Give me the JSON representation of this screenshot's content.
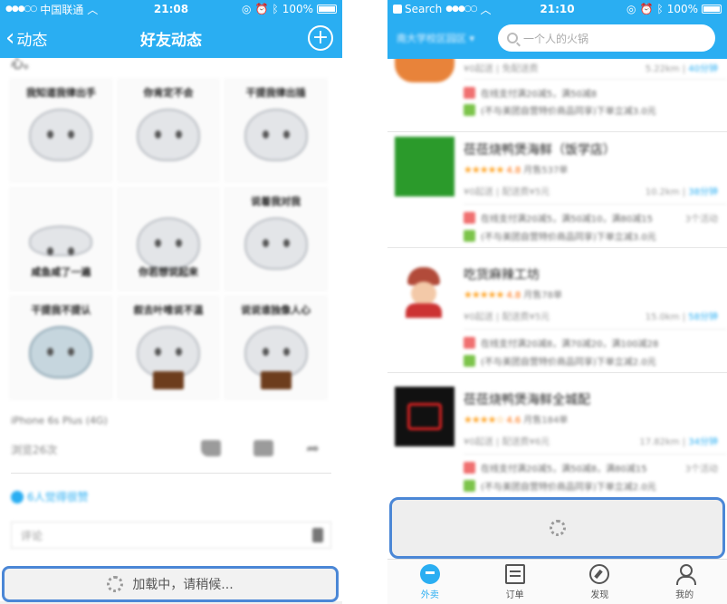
{
  "left_phone": {
    "status_bar": {
      "carrier": "中国联通",
      "time": "21:08",
      "battery": "100%"
    },
    "nav": {
      "back_label": "动态",
      "title": "好友动态",
      "add_icon": "plus-circle-icon"
    },
    "post": {
      "tail_text": "心。",
      "stickers": [
        {
          "caption": "我知道我律出手",
          "variant": "normal",
          "cap_pos": "top"
        },
        {
          "caption": "你肯定不会",
          "variant": "normal",
          "cap_pos": "top"
        },
        {
          "caption": "干提我律出插",
          "variant": "normal",
          "cap_pos": "top"
        },
        {
          "caption": "咸鱼咸了一遍",
          "variant": "flat",
          "cap_pos": "bottom"
        },
        {
          "caption": "你若想说起来",
          "variant": "normal",
          "cap_pos": "bottom"
        },
        {
          "caption": "说着我对我",
          "variant": "normal",
          "cap_pos": "top"
        },
        {
          "caption": "干提我不提认",
          "variant": "blue",
          "cap_pos": "top"
        },
        {
          "caption": "叙去叶唯说不温",
          "variant": "book",
          "cap_pos": "top"
        },
        {
          "caption": "说说谁独像人心",
          "variant": "book",
          "cap_pos": "top"
        }
      ],
      "device": "iPhone 6s Plus (4G)",
      "views": "浏览26次",
      "liked": "6人觉得很赞",
      "comment_placeholder": "评论"
    },
    "loading_text": "加载中，请稍候..."
  },
  "right_phone": {
    "status_bar": {
      "back_app": "Search",
      "time": "21:10",
      "battery": "100%"
    },
    "header": {
      "address": "南大学校区园区",
      "search_placeholder": "一个人的火锅"
    },
    "shops": [
      {
        "name": "",
        "logo_color": "#e8833a",
        "stars": "",
        "score": "",
        "sales": "",
        "fee": "¥0起送 | 免配送费",
        "distance": "5.22km",
        "time": "40分钟",
        "promos": [
          "在线支付满20减5，满50减8",
          "(不与美团自营特价商品同享)下单立减3.0元"
        ],
        "promo_count": ""
      },
      {
        "name": "莅莅烧鸭煲海鲜（饭学店）",
        "logo_color": "#2b9a2b",
        "stars": "★★★★★",
        "score": "4.8",
        "sales": "月售537单",
        "fee": "¥0起送 | 配送费¥5元",
        "distance": "10.2km",
        "time": "38分钟",
        "promos": [
          "在线支付满20减5，满50减10，满80减15",
          "(不与美团自营特价商品同享)下单立减3.0元"
        ],
        "promo_count": "3个活动"
      },
      {
        "name": "吃货麻辣工坊",
        "logo_color": "#b24b3a",
        "stars": "★★★★★",
        "score": "4.8",
        "sales": "月售78单",
        "fee": "¥0起送 | 配送费¥5元",
        "distance": "15.0km",
        "time": "58分钟",
        "promos": [
          "在线支付满20减8，满70减20，满100减28",
          "(不与美团自营特价商品同享)下单立减2.0元"
        ],
        "promo_count": ""
      },
      {
        "name": "莅莅烧鸭煲海鲜全城配",
        "logo_color": "#111111",
        "stars": "★★★★☆",
        "score": "4.6",
        "sales": "月售184单",
        "fee": "¥0起送 | 配送费¥6元",
        "distance": "17.82km",
        "time": "34分钟",
        "promos": [
          "在线支付满20减5，满50减8，满80减15",
          "(不与美团自营特价商品同享)下单立减2.0元"
        ],
        "promo_count": "3个活动"
      }
    ],
    "tabs": [
      {
        "label": "外卖",
        "icon": "eleme-logo-icon",
        "active": true
      },
      {
        "label": "订单",
        "icon": "order-list-icon",
        "active": false
      },
      {
        "label": "发现",
        "icon": "compass-icon",
        "active": false
      },
      {
        "label": "我的",
        "icon": "user-icon",
        "active": false
      }
    ]
  },
  "colors": {
    "brand_blue": "#2aaef2",
    "highlight_border": "#4b87d6",
    "star_orange": "#ff9f1a"
  }
}
